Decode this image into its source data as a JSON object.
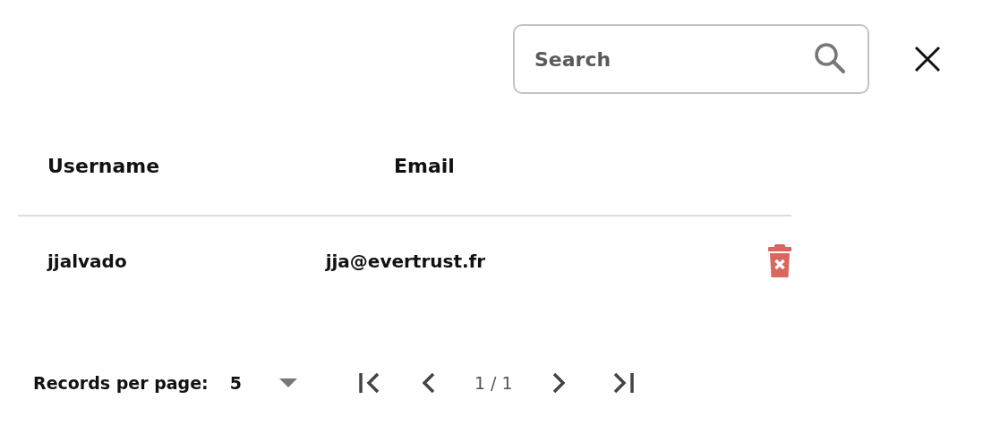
{
  "search": {
    "placeholder": "Search"
  },
  "table": {
    "columns": [
      "Username",
      "Email"
    ],
    "rows": [
      {
        "username": "jjalvado",
        "email": "jja@evertrust.fr"
      }
    ]
  },
  "pagination": {
    "records_label": "Records per page:",
    "records_per_page": "5",
    "page": "1 / 1"
  }
}
